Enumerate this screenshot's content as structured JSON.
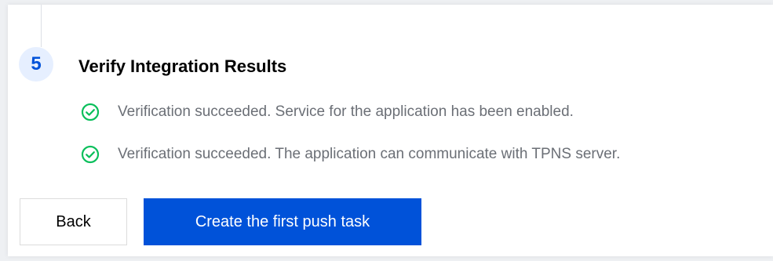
{
  "step": {
    "number": "5",
    "title": "Verify Integration Results"
  },
  "results": [
    {
      "icon": "check-circle-icon",
      "text": "Verification succeeded. Service for the application has been enabled."
    },
    {
      "icon": "check-circle-icon",
      "text": "Verification succeeded. The application can communicate with TPNS server."
    }
  ],
  "actions": {
    "back_label": "Back",
    "primary_label": "Create the first push task"
  },
  "colors": {
    "primary": "#0052d9",
    "success": "#0abf5b",
    "badge_bg": "#e6efff",
    "muted_text": "#6b6f76"
  }
}
